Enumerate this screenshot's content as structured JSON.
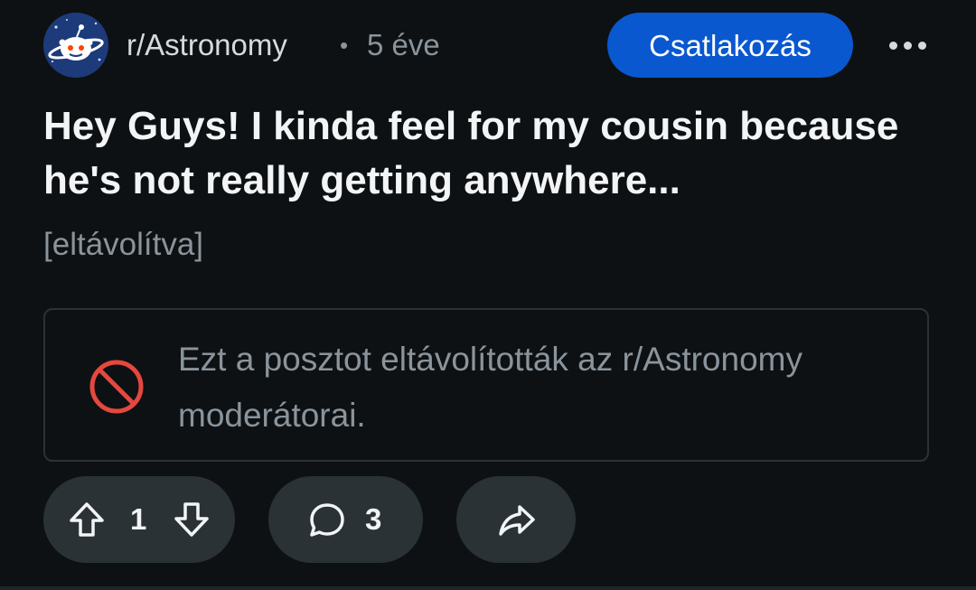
{
  "post": {
    "subreddit": "r/Astronomy",
    "separator": "•",
    "age": "5 éve",
    "title": "Hey Guys! I kinda feel for my cousin because he's not really getting anywhere...",
    "body": "[eltávolítva]",
    "removal_notice": "Ezt a posztot eltávolították az r/Astronomy moderátorai."
  },
  "header": {
    "join_label": "Csatlakozás"
  },
  "actions": {
    "vote_count": "1",
    "comment_count": "3"
  },
  "colors": {
    "background": "#0e1113",
    "accent": "#0a58d0",
    "pill": "#2a3236",
    "removed_icon": "#e5483e",
    "muted_text": "#8a949c"
  },
  "icons": {
    "avatar": "subreddit-avatar-icon",
    "more": "more-options-icon",
    "removed": "prohibited-icon",
    "upvote": "upvote-arrow-icon",
    "downvote": "downvote-arrow-icon",
    "comment": "comment-bubble-icon",
    "share": "share-arrow-icon"
  }
}
